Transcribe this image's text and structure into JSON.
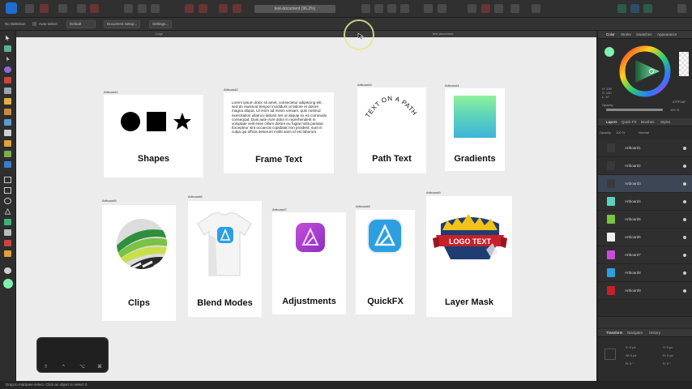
{
  "app": {
    "document_title": "test-document (96.2%)"
  },
  "context_toolbar": {
    "selection": "No Selection",
    "auto_select_label": "Auto-select:",
    "auto_select_value": "Default",
    "document_setup_label": "Document Setup...",
    "settings_label": "Settings..."
  },
  "doc_tabs": [
    "Logo",
    "test-document"
  ],
  "artboards": [
    {
      "label": "Artboard1",
      "title": "Shapes"
    },
    {
      "label": "Artboard2",
      "title": "Frame Text",
      "body": "Lorem ipsum dolor sit amet, consectetur adipiscing elit, sed do eiusmod tempor incididunt ut labore et dolore magna aliqua. Ut enim ad minim veniam, quis nostrud exercitation ullamco laboris nisi ut aliquip ex ea commodo consequat. Duis aute irure dolor in reprehenderit in voluptate velit esse cillum dolore eu fugiat nulla pariatur. Excepteur sint occaecat cupidatat non proident, sunt in culpa qui officia deserunt mollit anim id est laborum."
    },
    {
      "label": "Artboard3",
      "title": "Path Text",
      "path_text": "TEXT ON A PATH"
    },
    {
      "label": "Artboard4",
      "title": "Gradients"
    },
    {
      "label": "Artboard5",
      "title": "Clips"
    },
    {
      "label": "Artboard6",
      "title": "Blend Modes"
    },
    {
      "label": "Artboard7",
      "title": "Adjustments"
    },
    {
      "label": "Artboard8",
      "title": "QuickFX"
    },
    {
      "label": "Artboard9",
      "title": "Layer Mask",
      "logo_text": "LOGO TEXT"
    }
  ],
  "color_panel": {
    "tabs": [
      "Color",
      "Stroke",
      "Swatches",
      "Appearance"
    ],
    "hex_value": "#7FF0AF",
    "opacity_label": "Opacity",
    "opacity_value": "100 %",
    "h_label": "H: 139",
    "s_label": "S: 100",
    "l_label": "L: 97"
  },
  "layers_panel": {
    "tabs": [
      "Layers",
      "Quick FX",
      "Brushes",
      "Styles"
    ],
    "opacity_label": "Opacity:",
    "opacity_value": "100 %",
    "blend_mode": "Normal",
    "layers": [
      "Artboard1",
      "Artboard2",
      "Artboard3",
      "Artboard4",
      "Artboard5",
      "Artboard6",
      "Artboard7",
      "Artboard8",
      "Artboard9"
    ],
    "selected_index": 2
  },
  "transform_panel": {
    "tabs": [
      "Transform",
      "Navigator",
      "History"
    ],
    "x": "X: 0 px",
    "y": "Y: 0 px",
    "w": "W: 0 px",
    "h": "H: 0 px",
    "r": "R: 0 °",
    "s": "S: 0 °"
  },
  "status_bar": {
    "text": "Drag to marquee select. Click an object to select it."
  },
  "hud_keys": [
    "⇧",
    "^",
    "⌥",
    "⌘"
  ],
  "colors": {
    "accent_blue": "#1e6fd0",
    "canvas": "#ececec",
    "selected_layer": "#3c4654"
  }
}
